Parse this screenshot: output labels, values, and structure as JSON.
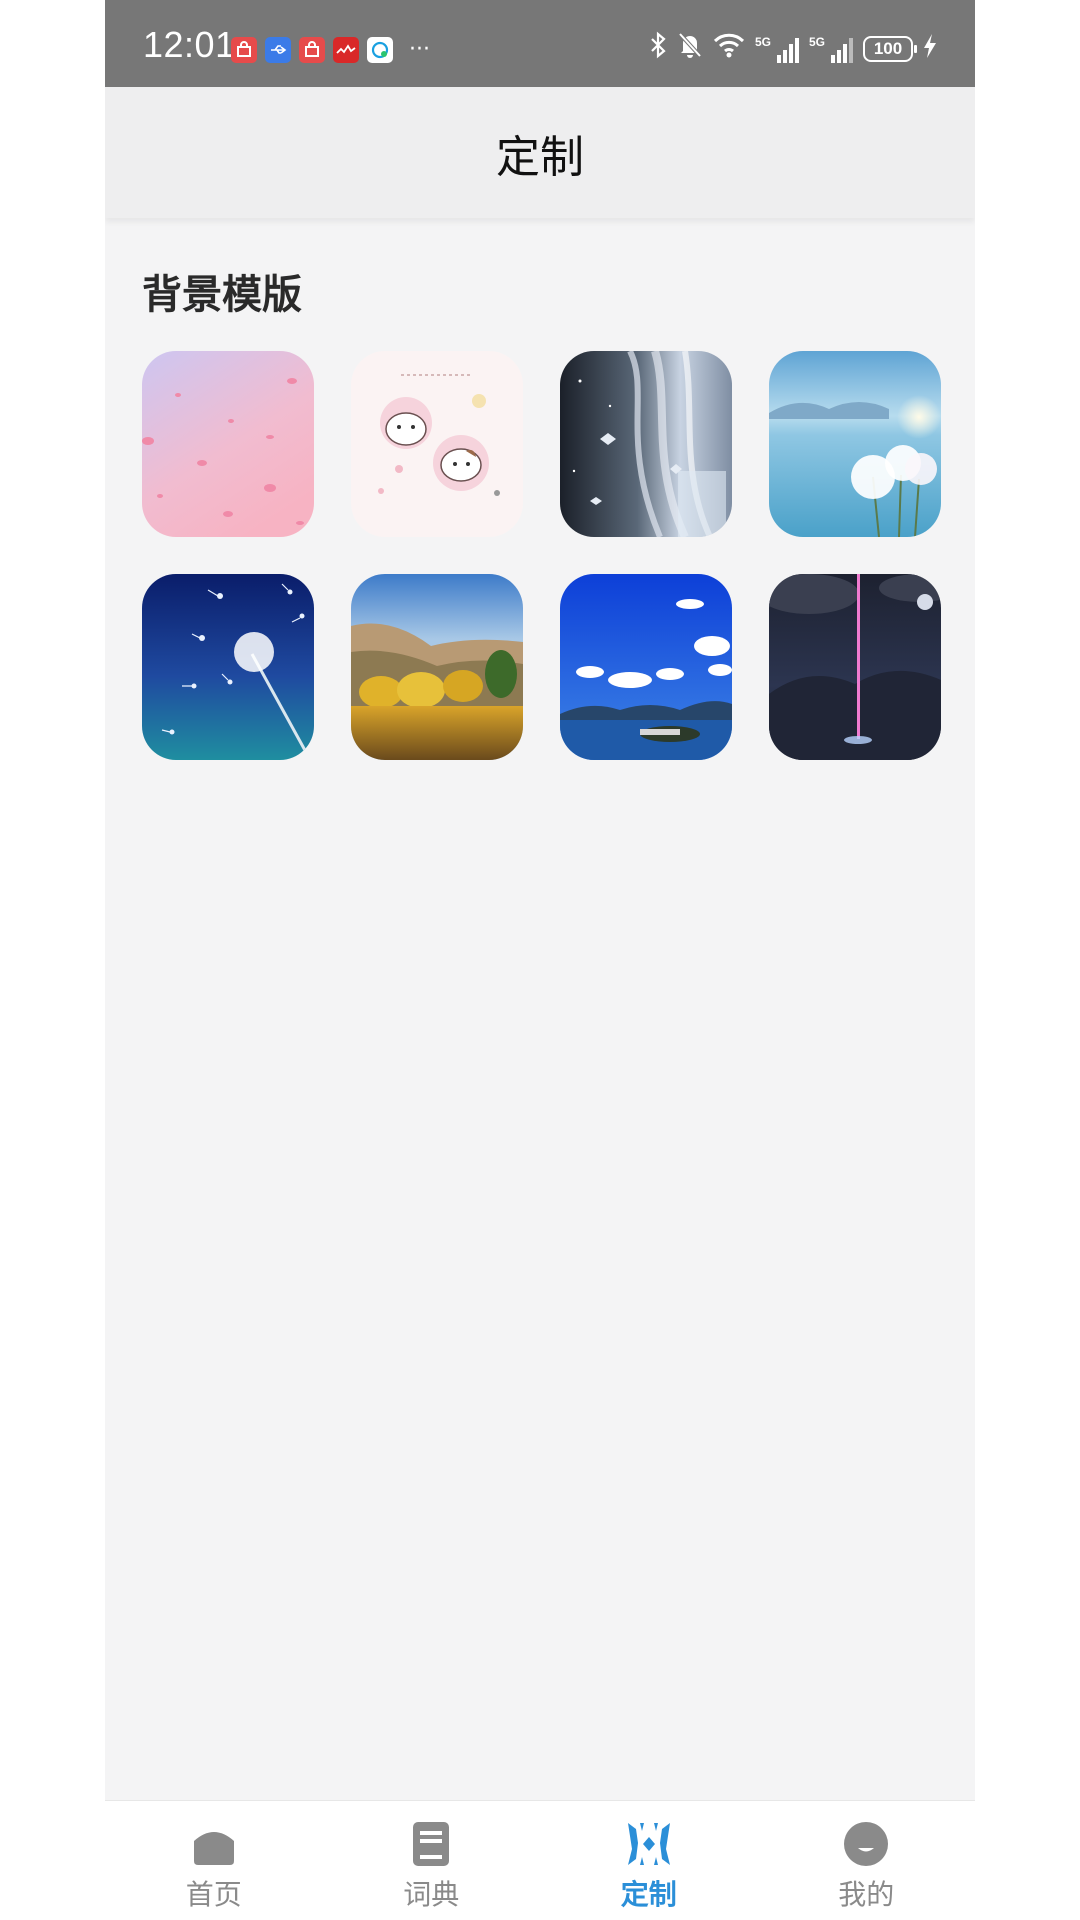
{
  "status_bar": {
    "time": "12:01",
    "more": "···",
    "battery": "100",
    "signal_tag_1": "5G",
    "signal_tag_2": "5G",
    "notification_icons": [
      "shopping-bag-icon",
      "usb-icon",
      "shopping-bag-icon",
      "stock-chart-icon",
      "chat-icon"
    ],
    "status_icons": [
      "bluetooth-icon",
      "mute-bell-icon",
      "wifi-icon",
      "signal-5g-icon",
      "signal-5g-icon",
      "battery-icon",
      "charging-icon"
    ]
  },
  "header": {
    "title": "定制"
  },
  "section": {
    "title": "背景模版"
  },
  "templates": [
    {
      "name": "pink-petals"
    },
    {
      "name": "cartoon-cats"
    },
    {
      "name": "butterfly-curtain"
    },
    {
      "name": "white-flowers-lake"
    },
    {
      "name": "dandelion-blue"
    },
    {
      "name": "autumn-lake"
    },
    {
      "name": "blue-sky-lake"
    },
    {
      "name": "night-light-beam"
    }
  ],
  "bottom_nav": {
    "items": [
      {
        "label": "首页",
        "icon": "home-icon",
        "active": false
      },
      {
        "label": "词典",
        "icon": "book-icon",
        "active": false
      },
      {
        "label": "定制",
        "icon": "customize-icon",
        "active": true
      },
      {
        "label": "我的",
        "icon": "profile-icon",
        "active": false
      }
    ],
    "active_color": "#2b8fd8",
    "inactive_color": "#8a8a8a"
  },
  "colors": {
    "status_bar": "#777777",
    "header_bg": "#eeeeef",
    "page_bg": "#f4f4f5"
  }
}
